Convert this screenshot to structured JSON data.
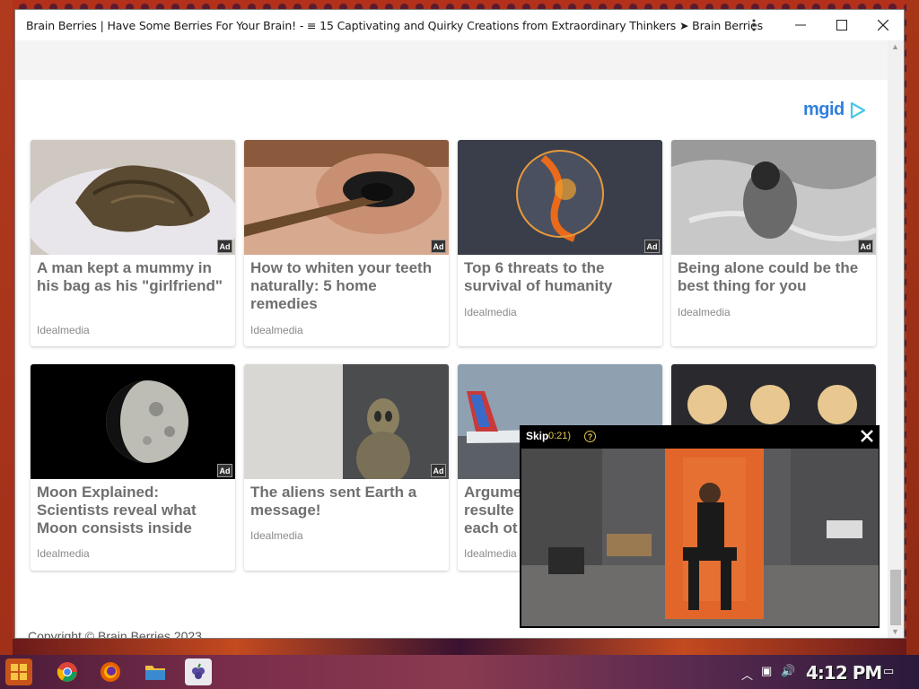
{
  "window": {
    "title": "Brain Berries | Have Some Berries For Your Brain! - ≡ 15 Captivating and Quirky Creations from Extraordinary Thinkers ➤ Brain Berries"
  },
  "ad_network": {
    "logo_text": "mgid"
  },
  "cards": [
    {
      "headline": "A man kept a mummy in his bag as his \"girlfriend\"",
      "source": "Idealmedia",
      "badge": "Ad"
    },
    {
      "headline": "How to whiten your teeth naturally: 5 home remedies",
      "source": "Idealmedia",
      "badge": "Ad"
    },
    {
      "headline": "Top 6 threats to the survival of humanity",
      "source": "Idealmedia",
      "badge": "Ad"
    },
    {
      "headline": "Being alone could be the best thing for you",
      "source": "Idealmedia",
      "badge": "Ad"
    },
    {
      "headline": "Moon Explained: Scientists reveal what Moon consists inside",
      "source": "Idealmedia",
      "badge": "Ad"
    },
    {
      "headline": "The aliens sent Earth a message!",
      "source": "Idealmedia",
      "badge": "Ad"
    },
    {
      "headline": "Argume resulte each ot",
      "source": "Idealmedia",
      "badge": ""
    },
    {
      "headline": "",
      "source": "",
      "badge": ""
    }
  ],
  "footer": {
    "copyright": "Copyright © Brain Berries 2023"
  },
  "video_popup": {
    "skip_label": "Skip",
    "timer": "0:21)",
    "close_icon": "close-icon"
  },
  "taskbar": {
    "clock": "4:12 PM"
  },
  "colors": {
    "accent": "#2f7fdc",
    "headline_gray": "#6f6f6f",
    "source_gray": "#8a8a8a"
  }
}
